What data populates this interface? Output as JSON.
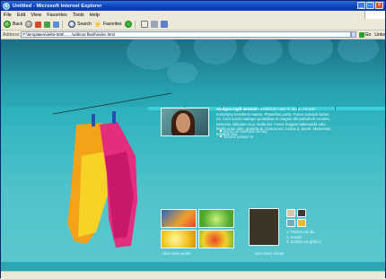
{
  "window": {
    "title": "Untitled - Microsoft Internet Explorer",
    "controls": [
      "_",
      "□",
      "×"
    ]
  },
  "menu": [
    "File",
    "Edit",
    "View",
    "Favorites",
    "Tools",
    "Help"
  ],
  "toolbar": {
    "back_label": "Back",
    "search_label": "Search",
    "favorites_label": "Favorites"
  },
  "address": {
    "label": "Address",
    "url": "F:\\templates\\delta-006\\.......\\without flash\\index.html",
    "go_label": "Go",
    "links_label": "Links"
  },
  "site": {
    "intro_title": "Aedigna inglit aesenet",
    "intro_text": "vestibulum color fe lacus. Aenean nonummy hendrerit mauris. Phasellus porta. Fusce suscipit varius mi. Cum sociis natoque penatibus et magnis dis parturient montes, nascetur ridiculus mus. Nulla dui. Fusce feugiat malesuada odio. Morbi nunc odio, gravida at, cursus nec, luctus a, lorem. Maecenas tristique orci.",
    "intro_links": [
      "Donec sit aveertas versaq",
      "aenalar pelauin fe"
    ],
    "view_works": "view more works",
    "view_clients": "view more clients",
    "ordered_links": [
      "1. Passim ab illo",
      "2. Inventi",
      "3. Exhibit est ghilicci"
    ]
  },
  "colors": {
    "page_bg": "#2bb1bc",
    "header_bg": "#1c6f82",
    "nav_bar": "#3cd0dd",
    "titlebar": "#0a3fbf"
  }
}
